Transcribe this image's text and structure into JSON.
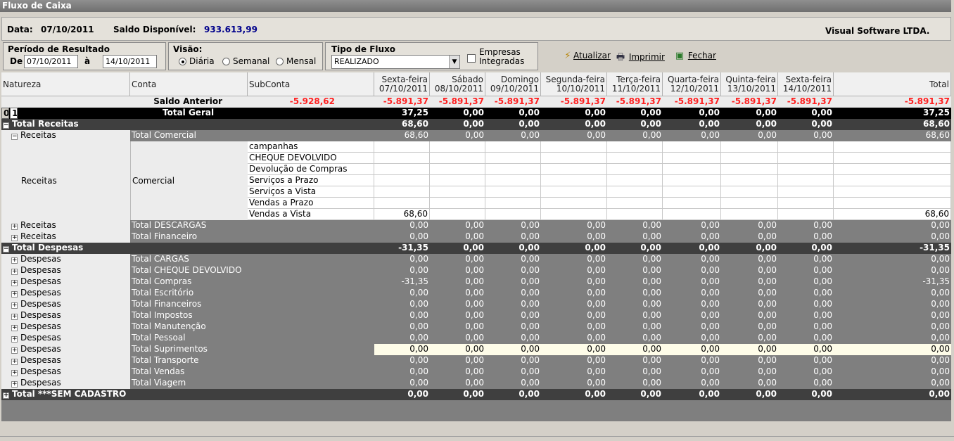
{
  "window": {
    "title": "Fluxo de Caixa"
  },
  "info": {
    "data_label": "Data:",
    "data_value": "07/10/2011",
    "saldo_label": "Saldo Disponível:",
    "saldo_value": "933.613,99",
    "company": "Visual Software LTDA."
  },
  "periodo": {
    "title": "Período de Resultado",
    "de_label": "De",
    "de_value": "07/10/2011",
    "a_label": "à",
    "ate_value": "14/10/2011"
  },
  "visao": {
    "title": "Visão:",
    "options": [
      "Diária",
      "Semanal",
      "Mensal"
    ],
    "selected": "Diária"
  },
  "tipo": {
    "title": "Tipo de Fluxo",
    "value": "REALIZADO",
    "empresas_line1": "Empresas",
    "empresas_line2": "Integradas"
  },
  "toolbar": {
    "atualizar": "Atualizar",
    "imprimir": "Imprimir",
    "fechar": "Fechar"
  },
  "columns": {
    "natureza": "Natureza",
    "conta": "Conta",
    "subconta": "SubConta",
    "days": [
      {
        "name": "Sexta-feira",
        "date": "07/10/2011"
      },
      {
        "name": "Sábado",
        "date": "08/10/2011"
      },
      {
        "name": "Domingo",
        "date": "09/10/2011"
      },
      {
        "name": "Segunda-feira",
        "date": "10/10/2011"
      },
      {
        "name": "Terça-feira",
        "date": "11/10/2011"
      },
      {
        "name": "Quarta-feira",
        "date": "12/10/2011"
      },
      {
        "name": "Quinta-feira",
        "date": "13/10/2011"
      },
      {
        "name": "Sexta-feira",
        "date": "14/10/2011"
      }
    ],
    "total": "Total"
  },
  "saldo_anterior": {
    "label": "Saldo Anterior",
    "value": "-5.928,62",
    "values": [
      "-5.891,37",
      "-5.891,37",
      "-5.891,37",
      "-5.891,37",
      "-5.891,37",
      "-5.891,37",
      "-5.891,37",
      "-5.891,37"
    ],
    "total": "-5.891,37"
  },
  "total_geral": {
    "levels": [
      "0",
      "1"
    ],
    "label": "Total Geral",
    "values": [
      "37,25",
      "0,00",
      "0,00",
      "0,00",
      "0,00",
      "0,00",
      "0,00",
      "0,00"
    ],
    "total": "37,25"
  },
  "total_receitas": {
    "label": "Total Receitas",
    "values": [
      "68,60",
      "0,00",
      "0,00",
      "0,00",
      "0,00",
      "0,00",
      "0,00",
      "0,00"
    ],
    "total": "68,60"
  },
  "receitas_comercial": {
    "natureza": "Receitas",
    "conta": "Total Comercial",
    "values": [
      "68,60",
      "0,00",
      "0,00",
      "0,00",
      "0,00",
      "0,00",
      "0,00",
      "0,00"
    ],
    "total": "68,60"
  },
  "comercial_group": {
    "natureza": "Receitas",
    "conta": "Comercial",
    "subcontas": [
      {
        "name": "campanhas",
        "v0": "",
        "total": ""
      },
      {
        "name": "CHEQUE DEVOLVIDO",
        "v0": "",
        "total": ""
      },
      {
        "name": "Devolução de Compras",
        "v0": "",
        "total": ""
      },
      {
        "name": "Serviços a Prazo",
        "v0": "",
        "total": ""
      },
      {
        "name": "Serviços a Vista",
        "v0": "",
        "total": ""
      },
      {
        "name": "Vendas a Prazo",
        "v0": "",
        "total": ""
      },
      {
        "name": "Vendas a Vista",
        "v0": "68,60",
        "total": "68,60"
      }
    ]
  },
  "receitas_rows": [
    {
      "natureza": "Receitas",
      "conta": "Total DESCARGAS",
      "values": [
        "0,00",
        "0,00",
        "0,00",
        "0,00",
        "0,00",
        "0,00",
        "0,00",
        "0,00"
      ],
      "total": "0,00"
    },
    {
      "natureza": "Receitas",
      "conta": "Total Financeiro",
      "values": [
        "0,00",
        "0,00",
        "0,00",
        "0,00",
        "0,00",
        "0,00",
        "0,00",
        "0,00"
      ],
      "total": "0,00"
    }
  ],
  "total_despesas": {
    "label": "Total Despesas",
    "values": [
      "-31,35",
      "0,00",
      "0,00",
      "0,00",
      "0,00",
      "0,00",
      "0,00",
      "0,00"
    ],
    "total": "-31,35"
  },
  "despesas_rows": [
    {
      "natureza": "Despesas",
      "conta": "Total CARGAS",
      "values": [
        "0,00",
        "0,00",
        "0,00",
        "0,00",
        "0,00",
        "0,00",
        "0,00",
        "0,00"
      ],
      "total": "0,00"
    },
    {
      "natureza": "Despesas",
      "conta": "Total CHEQUE DEVOLVIDO",
      "values": [
        "0,00",
        "0,00",
        "0,00",
        "0,00",
        "0,00",
        "0,00",
        "0,00",
        "0,00"
      ],
      "total": "0,00"
    },
    {
      "natureza": "Despesas",
      "conta": "Total Compras",
      "values": [
        "-31,35",
        "0,00",
        "0,00",
        "0,00",
        "0,00",
        "0,00",
        "0,00",
        "0,00"
      ],
      "total": "-31,35"
    },
    {
      "natureza": "Despesas",
      "conta": "Total Escritório",
      "values": [
        "0,00",
        "0,00",
        "0,00",
        "0,00",
        "0,00",
        "0,00",
        "0,00",
        "0,00"
      ],
      "total": "0,00"
    },
    {
      "natureza": "Despesas",
      "conta": "Total Financeiros",
      "values": [
        "0,00",
        "0,00",
        "0,00",
        "0,00",
        "0,00",
        "0,00",
        "0,00",
        "0,00"
      ],
      "total": "0,00"
    },
    {
      "natureza": "Despesas",
      "conta": "Total Impostos",
      "values": [
        "0,00",
        "0,00",
        "0,00",
        "0,00",
        "0,00",
        "0,00",
        "0,00",
        "0,00"
      ],
      "total": "0,00"
    },
    {
      "natureza": "Despesas",
      "conta": "Total Manutenção",
      "values": [
        "0,00",
        "0,00",
        "0,00",
        "0,00",
        "0,00",
        "0,00",
        "0,00",
        "0,00"
      ],
      "total": "0,00"
    },
    {
      "natureza": "Despesas",
      "conta": "Total Pessoal",
      "values": [
        "0,00",
        "0,00",
        "0,00",
        "0,00",
        "0,00",
        "0,00",
        "0,00",
        "0,00"
      ],
      "total": "0,00"
    },
    {
      "natureza": "Despesas",
      "conta": "Total Suprimentos",
      "values": [
        "0,00",
        "0,00",
        "0,00",
        "0,00",
        "0,00",
        "0,00",
        "0,00",
        "0,00"
      ],
      "total": "0,00",
      "highlight": true
    },
    {
      "natureza": "Despesas",
      "conta": "Total Transporte",
      "values": [
        "0,00",
        "0,00",
        "0,00",
        "0,00",
        "0,00",
        "0,00",
        "0,00",
        "0,00"
      ],
      "total": "0,00"
    },
    {
      "natureza": "Despesas",
      "conta": "Total Vendas",
      "values": [
        "0,00",
        "0,00",
        "0,00",
        "0,00",
        "0,00",
        "0,00",
        "0,00",
        "0,00"
      ],
      "total": "0,00"
    },
    {
      "natureza": "Despesas",
      "conta": "Total Viagem",
      "values": [
        "0,00",
        "0,00",
        "0,00",
        "0,00",
        "0,00",
        "0,00",
        "0,00",
        "0,00"
      ],
      "total": "0,00"
    }
  ],
  "total_sem_cadastro": {
    "label": "Total ***SEM CADASTRO",
    "values": [
      "0,00",
      "0,00",
      "0,00",
      "0,00",
      "0,00",
      "0,00",
      "0,00",
      "0,00"
    ],
    "total": "0,00"
  },
  "icons": {
    "atualizar": "refresh-icon",
    "imprimir": "printer-icon",
    "fechar": "exit-door-icon",
    "dropdown": "chevron-down-icon",
    "expand": "plus-box-icon",
    "collapse": "minus-box-icon"
  }
}
